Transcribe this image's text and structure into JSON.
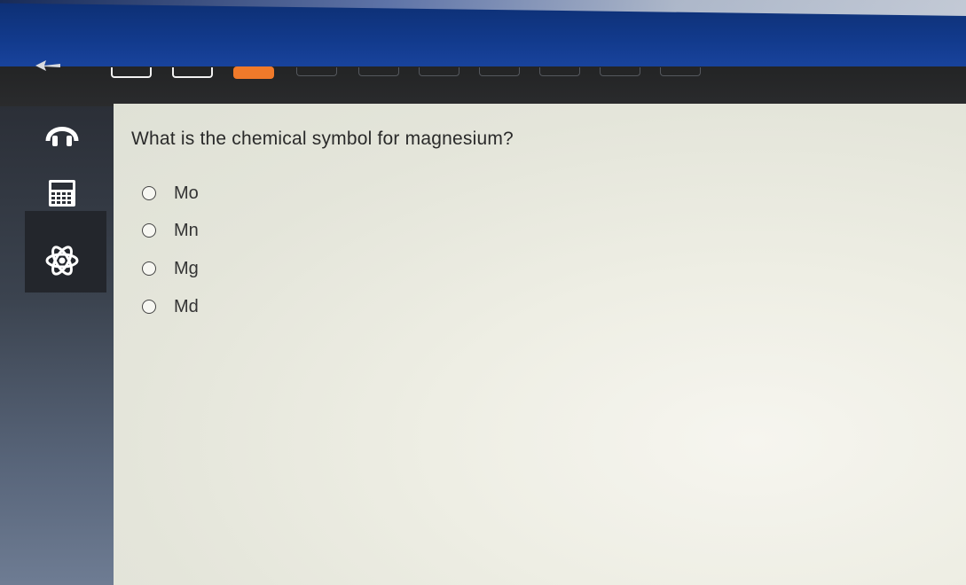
{
  "header": {
    "question_nav": [
      {
        "state": "done"
      },
      {
        "state": "done"
      },
      {
        "state": "current"
      },
      {
        "state": "upcoming"
      },
      {
        "state": "upcoming"
      },
      {
        "state": "upcoming"
      },
      {
        "state": "upcoming"
      },
      {
        "state": "upcoming"
      },
      {
        "state": "upcoming"
      },
      {
        "state": "upcoming"
      }
    ],
    "current_color": "#f07a2a"
  },
  "sidebar": {
    "tools": [
      {
        "icon": "headphones-icon"
      },
      {
        "icon": "calculator-icon"
      },
      {
        "icon": "atom-icon"
      }
    ]
  },
  "question": {
    "text": "What is the chemical symbol for magnesium?",
    "options": [
      {
        "label": "Mo"
      },
      {
        "label": "Mn"
      },
      {
        "label": "Mg"
      },
      {
        "label": "Md"
      }
    ]
  }
}
